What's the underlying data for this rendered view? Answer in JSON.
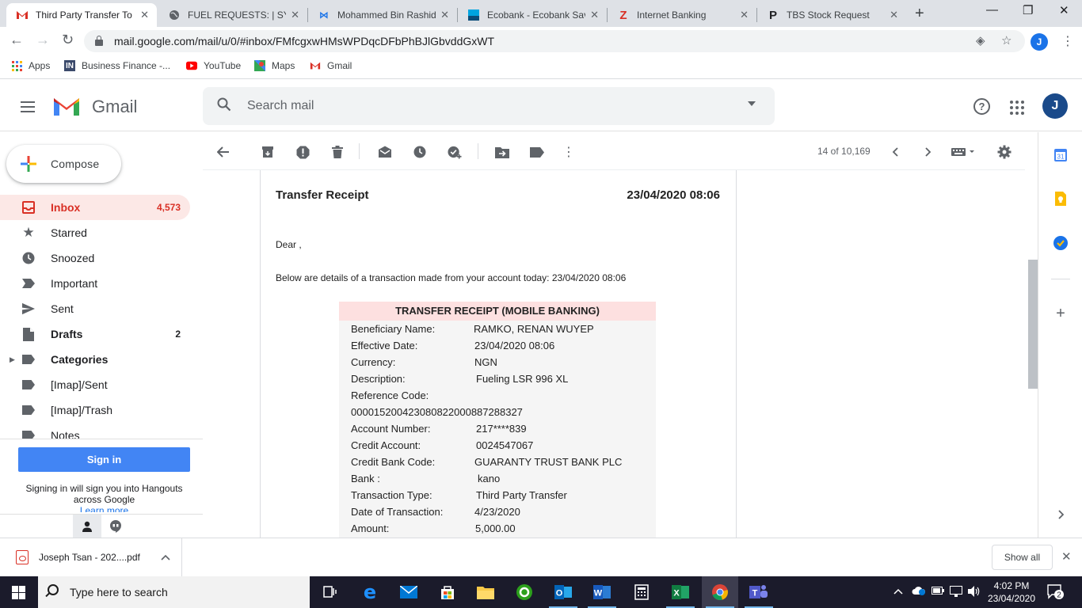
{
  "browser": {
    "tabs": [
      {
        "title": "Third Party Transfer To Ba",
        "favicon": "gmail-icon",
        "active": true
      },
      {
        "title": "FUEL REQUESTS: | SYSTEM",
        "favicon": "globe-icon",
        "active": false
      },
      {
        "title": "Mohammed Bin Rashid",
        "favicon": "m-icon",
        "active": false
      },
      {
        "title": "Ecobank - Ecobank Savings",
        "favicon": "ecobank-icon",
        "active": false
      },
      {
        "title": "Internet Banking",
        "favicon": "z-icon",
        "active": false
      },
      {
        "title": "TBS Stock Request",
        "favicon": "p-icon",
        "active": false
      }
    ],
    "close_glyph": "✕",
    "new_tab_glyph": "+",
    "url": "mail.google.com/mail/u/0/#inbox/FMfcgxwHMsWPDqcDFbPhBJlGbvddGxWT",
    "profile_initial": "J",
    "bookmarks": [
      {
        "label": "Apps"
      },
      {
        "label": "Business Finance -..."
      },
      {
        "label": "YouTube"
      },
      {
        "label": "Maps"
      },
      {
        "label": "Gmail"
      }
    ]
  },
  "gmail": {
    "brand": "Gmail",
    "search_placeholder": "Search mail",
    "avatar_initial": "J",
    "compose_label": "Compose",
    "nav": [
      {
        "label": "Inbox",
        "count": "4,573",
        "icon": "inbox-icon"
      },
      {
        "label": "Starred",
        "count": "",
        "icon": "star-icon"
      },
      {
        "label": "Snoozed",
        "count": "",
        "icon": "clock-icon"
      },
      {
        "label": "Important",
        "count": "",
        "icon": "important-icon"
      },
      {
        "label": "Sent",
        "count": "",
        "icon": "send-icon"
      },
      {
        "label": "Drafts",
        "count": "2",
        "icon": "draft-icon"
      },
      {
        "label": "Categories",
        "count": "",
        "icon": "label-icon"
      },
      {
        "label": "[Imap]/Sent",
        "count": "",
        "icon": "label-icon"
      },
      {
        "label": "[Imap]/Trash",
        "count": "",
        "icon": "label-icon"
      },
      {
        "label": "Notes",
        "count": "",
        "icon": "label-icon"
      }
    ],
    "hangouts": {
      "signin_label": "Sign in",
      "signin_text": "Signing in will sign you into Hangouts across Google",
      "learn_more": "Learn more"
    },
    "toolbar": {
      "page_count": "14 of 10,169"
    },
    "calendar_day": "31"
  },
  "message": {
    "title": "Transfer Receipt",
    "datetime": "23/04/2020 08:06",
    "greeting": "Dear ,",
    "intro": "Below are details of a transaction made from your account today: 23/04/2020 08:06",
    "receipt_header": "TRANSFER RECEIPT (MOBILE BANKING)",
    "rows": [
      {
        "key": "Beneficiary Name:",
        "value": "RAMKO, RENAN WUYEP"
      },
      {
        "key": "Effective Date:",
        "value": "23/04/2020 08:06"
      },
      {
        "key": "Currency:",
        "value": "NGN"
      },
      {
        "key": "Description:",
        "value": "Fueling LSR 996 XL"
      },
      {
        "key": "Reference Code:",
        "value": ""
      },
      {
        "key": "000015200423080822000887288327",
        "value": ""
      },
      {
        "key": "Account Number:",
        "value": "217****839"
      },
      {
        "key": "Credit Account:",
        "value": "0024547067"
      },
      {
        "key": "Credit Bank Code:",
        "value": "GUARANTY TRUST BANK PLC"
      },
      {
        "key": "Bank :",
        "value": "kano"
      },
      {
        "key": "Transaction Type:",
        "value": "Third Party Transfer"
      },
      {
        "key": "Date of Transaction:",
        "value": "4/23/2020"
      },
      {
        "key": "Amount:",
        "value": "5,000.00"
      }
    ]
  },
  "downloads": {
    "file": "Joseph Tsan - 202....pdf",
    "show_all": "Show all"
  },
  "taskbar": {
    "search_placeholder": "Type here to search",
    "time": "4:02 PM",
    "date": "23/04/2020",
    "notification_count": "2"
  },
  "colors": {
    "gmail_red": "#d93025",
    "accent_blue": "#1a73e8",
    "inbox_active_bg": "#fce8e6",
    "receipt_header_bg": "#fde0e0"
  }
}
